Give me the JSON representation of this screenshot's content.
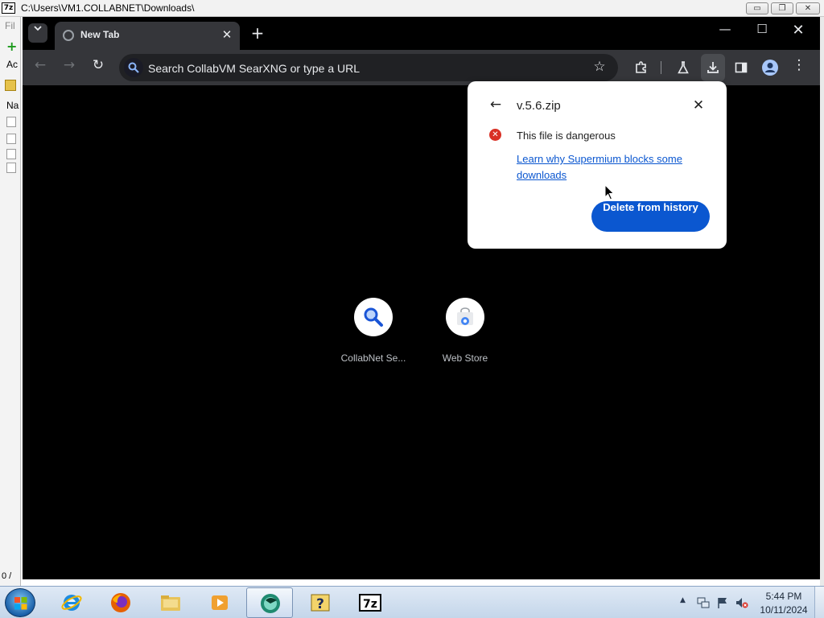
{
  "zip_window": {
    "logo": "7z",
    "title": "C:\\Users\\VM1.COLLABNET\\Downloads\\",
    "menu_file": "Fil",
    "add_label": "Ac",
    "column_name": "Na",
    "status": "0 / ",
    "controls": {
      "minimize": "▭",
      "maximize": "❐",
      "close": "✕"
    }
  },
  "browser": {
    "tab": {
      "title": "New Tab",
      "close": "✕"
    },
    "new_tab": "+",
    "window_controls": {
      "minimize": "—",
      "maximize": "☐",
      "close": "✕"
    },
    "toolbar": {
      "back": "←",
      "forward": "→",
      "reload": "↻",
      "omnibox_placeholder": "Search CollabVM SearXNG or type a URL",
      "bookmark": "☆",
      "menu": "⋮"
    },
    "ntp": {
      "tiles": [
        {
          "label": "CollabNet Se...",
          "icon": "search-icon"
        },
        {
          "label": "Web Store",
          "icon": "web-store-icon"
        }
      ]
    }
  },
  "download_bubble": {
    "filename": "v.5.6.zip",
    "warning": "This file is dangerous",
    "learn_link": "Learn why Supermium blocks some downloads",
    "delete_button": "Delete from history",
    "back": "←",
    "close": "✕",
    "error_icon_glyph": "✕"
  },
  "taskbar": {
    "apps": [
      "internet-explorer",
      "firefox",
      "windows-explorer",
      "windows-media-player",
      "supermium",
      "help",
      "7-zip"
    ],
    "active_app": "supermium",
    "tray_chevron": "▲",
    "clock_time": "5:44 PM",
    "clock_date": "10/11/2024",
    "help_glyph": "?",
    "zip_glyph": "7z"
  },
  "colors": {
    "accent": "#0b57d0",
    "danger": "#d93025",
    "toolbar": "#35363a",
    "page_background": "#000000"
  }
}
